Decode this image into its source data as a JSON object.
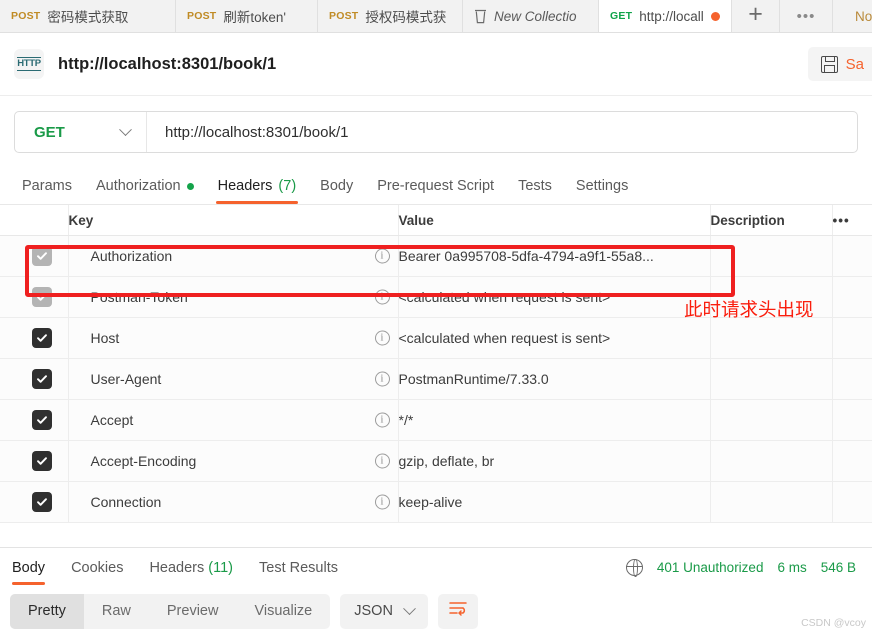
{
  "tabbar": {
    "tabs": [
      {
        "method": "POST",
        "name": "密码模式获取",
        "method_class": "post",
        "unsaved": false,
        "active": false
      },
      {
        "method": "POST",
        "name": "刷新token'",
        "method_class": "post",
        "unsaved": false,
        "active": false
      },
      {
        "method": "POST",
        "name": "授权码模式获",
        "method_class": "post",
        "unsaved": false,
        "active": false
      },
      {
        "method": "",
        "name": "New Collectio",
        "method_class": "collection",
        "unsaved": false,
        "active": false
      },
      {
        "method": "GET",
        "name": "http://locall",
        "method_class": "get",
        "unsaved": true,
        "active": true
      }
    ],
    "new_tab_label": "+",
    "more_label": "•••",
    "environment": "No Envi"
  },
  "title": {
    "icon_label": "HTTP",
    "request_name": "http://localhost:8301/book/1",
    "save_label": "Sa"
  },
  "url": {
    "method": "GET",
    "value": "http://localhost:8301/book/1"
  },
  "request_tabs": [
    {
      "label": "Params",
      "count": "",
      "active": false,
      "dot": false
    },
    {
      "label": "Authorization",
      "count": "",
      "active": false,
      "dot": true
    },
    {
      "label": "Headers",
      "count": "(7)",
      "active": true,
      "dot": false
    },
    {
      "label": "Body",
      "count": "",
      "active": false,
      "dot": false
    },
    {
      "label": "Pre-request Script",
      "count": "",
      "active": false,
      "dot": false
    },
    {
      "label": "Tests",
      "count": "",
      "active": false,
      "dot": false
    },
    {
      "label": "Settings",
      "count": "",
      "active": false,
      "dot": false
    }
  ],
  "headers_table": {
    "columns": [
      "Key",
      "Value",
      "Description"
    ],
    "more_label": "•••",
    "rows": [
      {
        "checked": true,
        "disabled": true,
        "key": "Authorization",
        "value": "Bearer 0a995708-5dfa-4794-a9f1-55a8...",
        "description": ""
      },
      {
        "checked": true,
        "disabled": true,
        "key": "Postman-Token",
        "value": "<calculated when request is sent>",
        "description": ""
      },
      {
        "checked": true,
        "disabled": false,
        "key": "Host",
        "value": "<calculated when request is sent>",
        "description": ""
      },
      {
        "checked": true,
        "disabled": false,
        "key": "User-Agent",
        "value": "PostmanRuntime/7.33.0",
        "description": ""
      },
      {
        "checked": true,
        "disabled": false,
        "key": "Accept",
        "value": "*/*",
        "description": ""
      },
      {
        "checked": true,
        "disabled": false,
        "key": "Accept-Encoding",
        "value": "gzip, deflate, br",
        "description": ""
      },
      {
        "checked": true,
        "disabled": false,
        "key": "Connection",
        "value": "keep-alive",
        "description": ""
      }
    ]
  },
  "annotation": {
    "text": "此时请求头出现",
    "color": "#fa1e0e"
  },
  "response": {
    "tabs": [
      {
        "label": "Body",
        "count": "",
        "active": true
      },
      {
        "label": "Cookies",
        "count": "",
        "active": false
      },
      {
        "label": "Headers",
        "count": "(11)",
        "active": false
      },
      {
        "label": "Test Results",
        "count": "",
        "active": false
      }
    ],
    "status": "401 Unauthorized",
    "time": "6 ms",
    "size": "546 B",
    "status_color": "#1a9a48"
  },
  "bottom_toolbar": {
    "view_modes": [
      {
        "label": "Pretty",
        "active": true
      },
      {
        "label": "Raw",
        "active": false
      },
      {
        "label": "Preview",
        "active": false
      },
      {
        "label": "Visualize",
        "active": false
      }
    ],
    "format": "JSON"
  },
  "watermark": "CSDN @vcoy"
}
